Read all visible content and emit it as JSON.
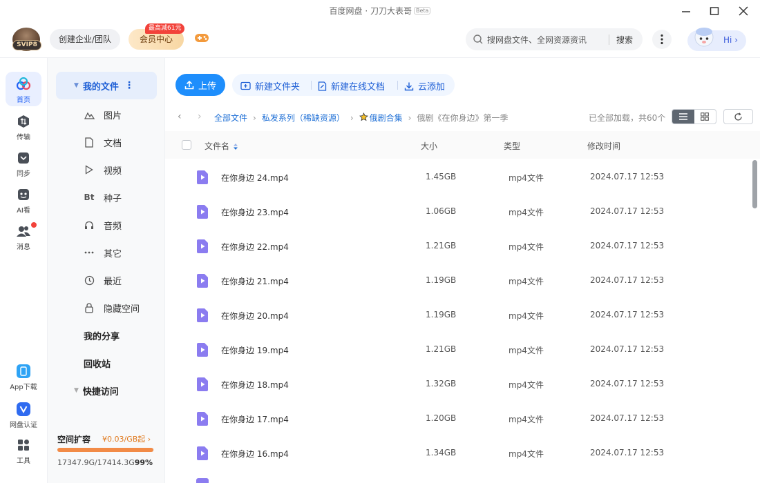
{
  "window": {
    "title": "百度网盘 · 刀刀大表哥",
    "beta": "Beta"
  },
  "header": {
    "svip": "SVIP8",
    "team_button": "创建企业/团队",
    "vip_center": "会员中心",
    "vip_badge": "最高减61元",
    "search_placeholder": "搜网盘文件、全网资源资讯",
    "search_button": "搜索",
    "hi": "Hi"
  },
  "rail": [
    {
      "label": "首页",
      "icon": "home-icon"
    },
    {
      "label": "传输",
      "icon": "transfer-icon"
    },
    {
      "label": "同步",
      "icon": "sync-icon"
    },
    {
      "label": "AI看",
      "icon": "ai-icon"
    },
    {
      "label": "消息",
      "icon": "message-icon"
    },
    {
      "label": "App下载",
      "icon": "phone-icon"
    },
    {
      "label": "网盘认证",
      "icon": "verify-icon"
    },
    {
      "label": "工具",
      "icon": "tools-icon"
    }
  ],
  "sidebar": {
    "my_files": "我的文件",
    "items": [
      {
        "label": "图片"
      },
      {
        "label": "文档"
      },
      {
        "label": "视频"
      },
      {
        "label": "种子",
        "icon_text": "Bt"
      },
      {
        "label": "音频"
      },
      {
        "label": "其它"
      },
      {
        "label": "最近"
      },
      {
        "label": "隐藏空间"
      }
    ],
    "my_share": "我的分享",
    "recycle": "回收站",
    "quick_access": "快捷访问",
    "storage": {
      "title": "空间扩容",
      "price": "¥0.03/GB起",
      "used_text": "17347.9G/17414.3G",
      "percent_text": "99%",
      "fraction": 0.99
    }
  },
  "toolbar": {
    "upload": "上传",
    "new_folder": "新建文件夹",
    "new_doc": "新建在线文档",
    "cloud_add": "云添加"
  },
  "breadcrumb": {
    "items": [
      "全部文件",
      "私发系列（稀缺资源）",
      "俄剧合集"
    ],
    "current": "俄剧《在你身边》第一季",
    "status": "已全部加载，共60个"
  },
  "table": {
    "headers": {
      "name": "文件名",
      "size": "大小",
      "type": "类型",
      "mtime": "修改时间"
    },
    "rows": [
      {
        "name": "在你身边 24.mp4",
        "size": "1.45GB",
        "type": "mp4文件",
        "mtime": "2024.07.17 12:53"
      },
      {
        "name": "在你身边 23.mp4",
        "size": "1.06GB",
        "type": "mp4文件",
        "mtime": "2024.07.17 12:53"
      },
      {
        "name": "在你身边 22.mp4",
        "size": "1.21GB",
        "type": "mp4文件",
        "mtime": "2024.07.17 12:53"
      },
      {
        "name": "在你身边 21.mp4",
        "size": "1.19GB",
        "type": "mp4文件",
        "mtime": "2024.07.17 12:53"
      },
      {
        "name": "在你身边 20.mp4",
        "size": "1.19GB",
        "type": "mp4文件",
        "mtime": "2024.07.17 12:53"
      },
      {
        "name": "在你身边 19.mp4",
        "size": "1.21GB",
        "type": "mp4文件",
        "mtime": "2024.07.17 12:53"
      },
      {
        "name": "在你身边 18.mp4",
        "size": "1.32GB",
        "type": "mp4文件",
        "mtime": "2024.07.17 12:53"
      },
      {
        "name": "在你身边 17.mp4",
        "size": "1.20GB",
        "type": "mp4文件",
        "mtime": "2024.07.17 12:53"
      },
      {
        "name": "在你身边 16.mp4",
        "size": "1.34GB",
        "type": "mp4文件",
        "mtime": "2024.07.17 12:53"
      }
    ]
  },
  "colors": {
    "accent": "#1e8efc",
    "link": "#1e6fd6",
    "video_icon": "#8b7cf0",
    "storage_fill": "#f28b47"
  }
}
